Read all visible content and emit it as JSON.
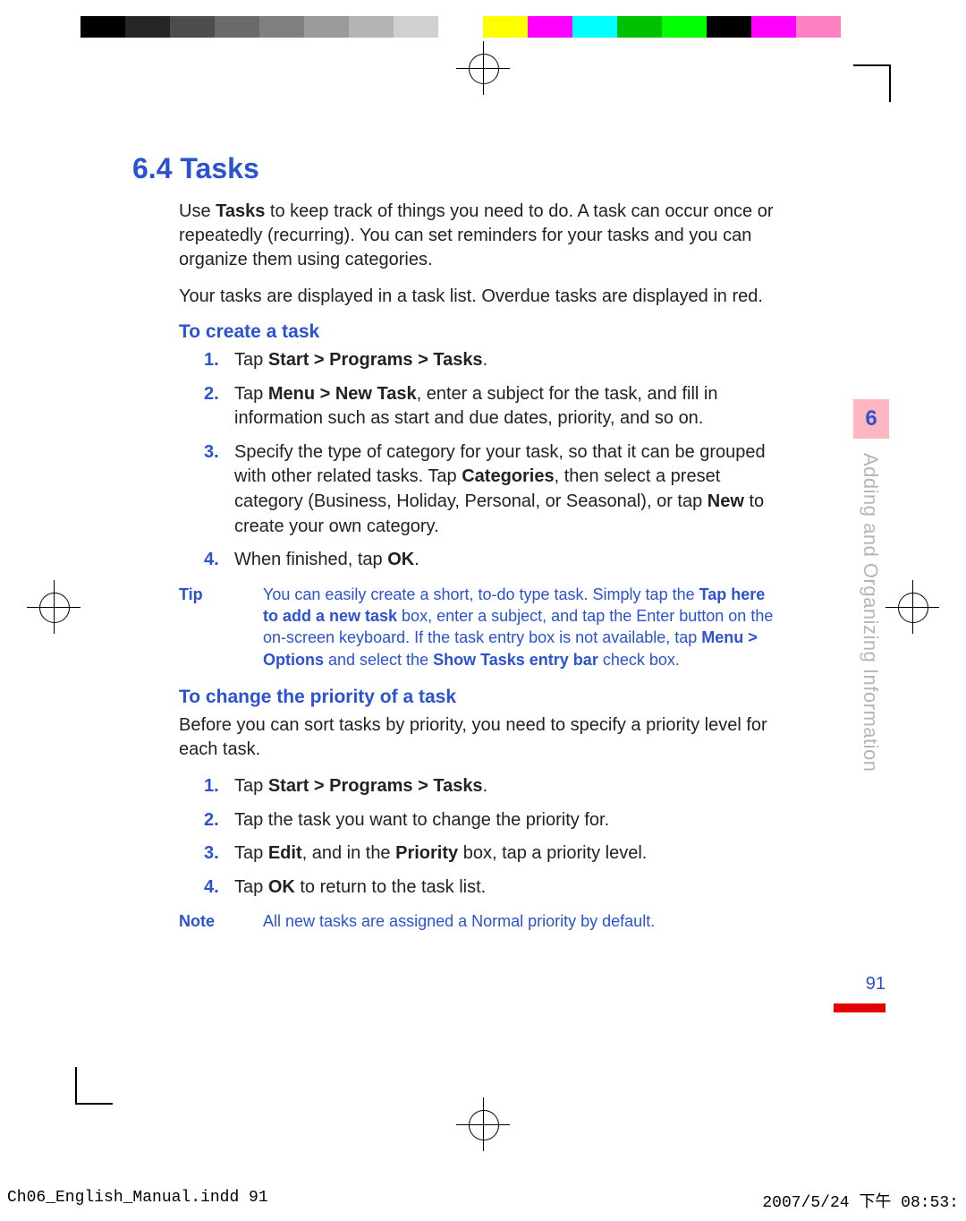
{
  "colorBar": [
    "#000000",
    "#262626",
    "#4d4d4d",
    "#6a6a6a",
    "#808080",
    "#9a9a9a",
    "#b4b4b4",
    "#d0d0d0",
    "#ffffff",
    "#ffff00",
    "#ff00ff",
    "#00ffff",
    "#00c000",
    "#00ff00",
    "#000000",
    "#ff00ff",
    "#ff80c0",
    "#ffffff"
  ],
  "section": {
    "number": "6.4",
    "title": "Tasks"
  },
  "intro": {
    "p1_pre": "Use ",
    "p1_bold": "Tasks",
    "p1_post": " to keep track of things you need to do. A task can occur once or repeatedly (recurring). You can set reminders for your tasks and you can organize them using categories.",
    "p2": "Your tasks are displayed in a task list. Overdue tasks are displayed in red."
  },
  "createTask": {
    "heading": "To create a task",
    "steps": [
      {
        "num": "1.",
        "pre": "Tap ",
        "bold": "Start > Programs > Tasks",
        "post": "."
      },
      {
        "num": "2.",
        "pre": "Tap ",
        "bold": "Menu > New Task",
        "post": ", enter a subject for the task, and fill in information such as start and due dates, priority, and so on."
      },
      {
        "num": "3.",
        "pre": "Specify the type of category for your task, so that it can be grouped with other related tasks. Tap ",
        "bold": "Categories",
        "post": ", then select a preset category (Business, Holiday, Personal, or Seasonal), or tap ",
        "bold2": "New",
        "post2": " to create your own category."
      },
      {
        "num": "4.",
        "pre": "When finished, tap ",
        "bold": "OK",
        "post": "."
      }
    ]
  },
  "tip": {
    "label": "Tip",
    "seg1": "You can easily create a short, to-do type task. Simply tap the ",
    "bold1": "Tap here to add a new task",
    "seg2": " box, enter a subject, and tap the Enter button on the on-screen keyboard. If the task entry box is not available, tap ",
    "bold2": "Menu > Options",
    "seg3": " and select the ",
    "bold3": "Show Tasks entry bar",
    "seg4": " check box."
  },
  "changePriority": {
    "heading": "To change the priority of a task",
    "intro": "Before you can sort tasks by priority, you need to specify a priority level for each task.",
    "steps": [
      {
        "num": "1.",
        "pre": "Tap ",
        "bold": "Start > Programs > Tasks",
        "post": "."
      },
      {
        "num": "2.",
        "pre": "Tap the task you want to change the priority for.",
        "bold": "",
        "post": ""
      },
      {
        "num": "3.",
        "pre": "Tap ",
        "bold": "Edit",
        "post": ", and in the ",
        "bold2": "Priority",
        "post2": " box, tap a priority level."
      },
      {
        "num": "4.",
        "pre": "Tap ",
        "bold": "OK",
        "post": " to return to the task list."
      }
    ]
  },
  "note": {
    "label": "Note",
    "text": "All new tasks are assigned a Normal priority by default."
  },
  "sidebar": {
    "chapterNumber": "6",
    "chapterTitle": "Adding and Organizing Information"
  },
  "pageNumber": "91",
  "footer": {
    "left": "Ch06_English_Manual.indd   91",
    "right": "2007/5/24   下午 08:53:"
  }
}
